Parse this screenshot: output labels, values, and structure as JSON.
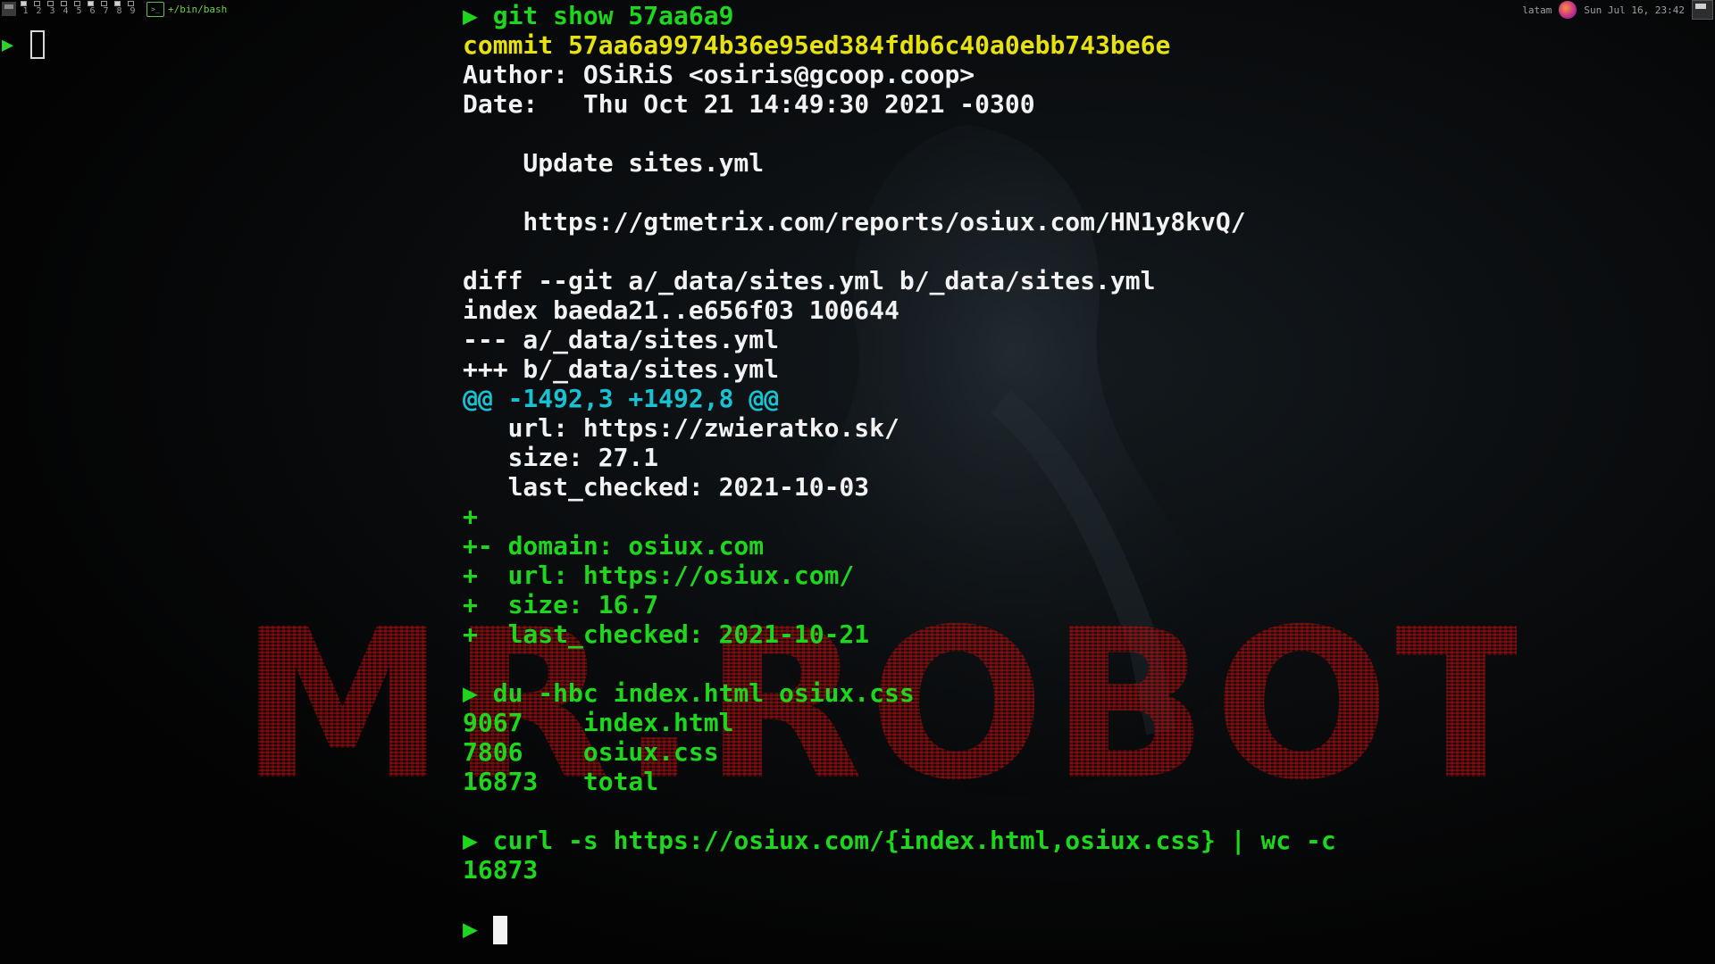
{
  "topbar": {
    "workspaces": [
      "1",
      "2",
      "3",
      "4",
      "5",
      "6",
      "7",
      "8",
      "9"
    ],
    "window_title": "+/bin/bash",
    "keyboard_layout": "latam",
    "clock": "Sun Jul 16, 23:42"
  },
  "left_pane": {
    "prompt": "▶"
  },
  "wallpaper": {
    "text": "MR.ROBOT"
  },
  "terminal": {
    "lines": [
      {
        "parts": [
          {
            "text": "▶ git show 57aa6a9",
            "color": "green"
          }
        ]
      },
      {
        "parts": [
          {
            "text": "commit 57aa6a9974b36e95ed384fdb6c40a0ebb743be6e",
            "color": "yellow"
          }
        ]
      },
      {
        "parts": [
          {
            "text": "Author: OSiRiS <osiris@gcoop.coop>",
            "color": "white"
          }
        ]
      },
      {
        "parts": [
          {
            "text": "Date:   Thu Oct 21 14:49:30 2021 -0300",
            "color": "white"
          }
        ]
      },
      {
        "parts": []
      },
      {
        "parts": [
          {
            "text": "    Update sites.yml",
            "color": "white"
          }
        ]
      },
      {
        "parts": []
      },
      {
        "parts": [
          {
            "text": "    https://gtmetrix.com/reports/osiux.com/HN1y8kvQ/",
            "color": "white"
          }
        ]
      },
      {
        "parts": []
      },
      {
        "parts": [
          {
            "text": "diff --git a/_data/sites.yml b/_data/sites.yml",
            "color": "white"
          }
        ]
      },
      {
        "parts": [
          {
            "text": "index baeda21..e656f03 100644",
            "color": "white"
          }
        ]
      },
      {
        "parts": [
          {
            "text": "--- a/_data/sites.yml",
            "color": "white"
          }
        ]
      },
      {
        "parts": [
          {
            "text": "+++ b/_data/sites.yml",
            "color": "white"
          }
        ]
      },
      {
        "parts": [
          {
            "text": "@@ -1492,3 +1492,8 @@",
            "color": "cyan"
          }
        ]
      },
      {
        "parts": [
          {
            "text": "   url: https://zwieratko.sk/",
            "color": "white"
          }
        ]
      },
      {
        "parts": [
          {
            "text": "   size: 27.1",
            "color": "white"
          }
        ]
      },
      {
        "parts": [
          {
            "text": "   last_checked: 2021-10-03",
            "color": "white"
          }
        ]
      },
      {
        "parts": [
          {
            "text": "+",
            "color": "green"
          }
        ]
      },
      {
        "parts": [
          {
            "text": "+- domain: osiux.com",
            "color": "green"
          }
        ]
      },
      {
        "parts": [
          {
            "text": "+  url: https://osiux.com/",
            "color": "green"
          }
        ]
      },
      {
        "parts": [
          {
            "text": "+  size: 16.7",
            "color": "green"
          }
        ]
      },
      {
        "parts": [
          {
            "text": "+  last_checked: 2021-10-21",
            "color": "green"
          }
        ]
      },
      {
        "parts": []
      },
      {
        "parts": [
          {
            "text": "▶ du -hbc index.html osiux.css",
            "color": "green"
          }
        ]
      },
      {
        "parts": [
          {
            "text": "9067    index.html",
            "color": "green"
          }
        ]
      },
      {
        "parts": [
          {
            "text": "7806    osiux.css",
            "color": "green"
          }
        ]
      },
      {
        "parts": [
          {
            "text": "16873   total",
            "color": "green"
          }
        ]
      },
      {
        "parts": []
      },
      {
        "parts": [
          {
            "text": "▶ curl -s https://osiux.com/{index.html,osiux.css} | wc -c",
            "color": "green"
          }
        ]
      },
      {
        "parts": [
          {
            "text": "16873",
            "color": "green"
          }
        ]
      },
      {
        "parts": []
      },
      {
        "parts": [
          {
            "text": "▶",
            "color": "green"
          }
        ],
        "cursor": true
      }
    ]
  }
}
